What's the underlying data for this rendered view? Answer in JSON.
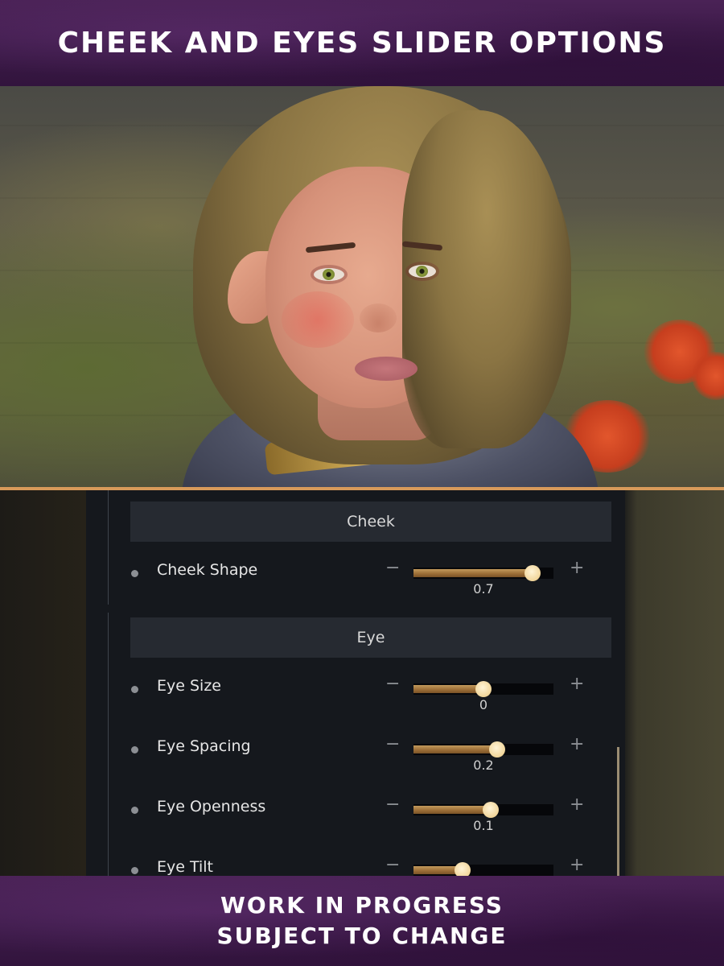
{
  "banner_top": {
    "title": "CHEEK AND EYES SLIDER OPTIONS"
  },
  "banner_bottom": {
    "line1": "WORK IN PROGRESS",
    "line2": "SUBJECT TO CHANGE"
  },
  "colors": {
    "banner_purple": "#3b1a47",
    "accent_gold": "#d89a5a",
    "slider_fill": "#a57a40",
    "slider_thumb": "#f1d59a",
    "panel_bg": "#15181d",
    "section_header_bg": "#262a31"
  },
  "slider_range": [
    -1,
    1
  ],
  "sections": [
    {
      "title": "Cheek",
      "sliders": [
        {
          "label": "Cheek Shape",
          "value": 0.7,
          "display": "0.7"
        }
      ]
    },
    {
      "title": "Eye",
      "sliders": [
        {
          "label": "Eye Size",
          "value": 0,
          "display": "0"
        },
        {
          "label": "Eye Spacing",
          "value": 0.2,
          "display": "0.2"
        },
        {
          "label": "Eye Openness",
          "value": 0.1,
          "display": "0.1"
        },
        {
          "label": "Eye Tilt",
          "value": -0.3,
          "display": ""
        }
      ]
    }
  ],
  "icons": {
    "decrease": "−",
    "increase": "+"
  }
}
